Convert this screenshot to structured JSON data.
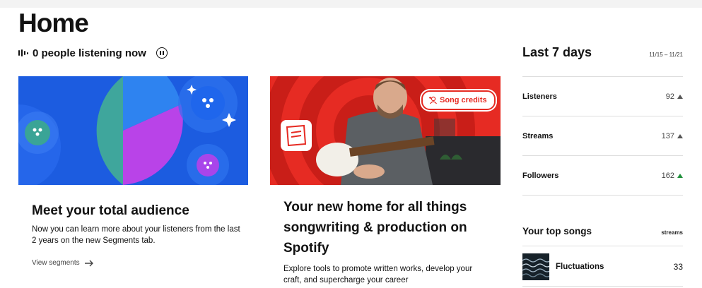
{
  "page": {
    "title": "Home"
  },
  "live": {
    "text": "0 people listening now"
  },
  "cards": [
    {
      "title": "Meet your total audience",
      "description": "Now you can learn more about your listeners from the last 2 years on the new Segments tab.",
      "link_label": "View segments"
    },
    {
      "badge": "Song credits",
      "title": "Your new home for all things songwriting & production on Spotify",
      "description": "Explore tools to promote written works, develop your craft, and supercharge your career"
    }
  ],
  "stats": {
    "title": "Last 7 days",
    "range": "11/15 – 11/21",
    "rows": [
      {
        "label": "Listeners",
        "value": "92",
        "trend": "up",
        "trend_color": "#555555"
      },
      {
        "label": "Streams",
        "value": "137",
        "trend": "up",
        "trend_color": "#555555"
      },
      {
        "label": "Followers",
        "value": "162",
        "trend": "up",
        "trend_color": "#1e8f3a"
      }
    ]
  },
  "top_songs": {
    "title": "Your top songs",
    "column": "streams",
    "items": [
      {
        "name": "Fluctuations",
        "streams": "33"
      }
    ]
  },
  "colors": {
    "accent_blue": "#1c5ce0",
    "accent_red": "#e62b23",
    "accent_purple": "#b943e8",
    "accent_teal": "#3fa69c"
  }
}
